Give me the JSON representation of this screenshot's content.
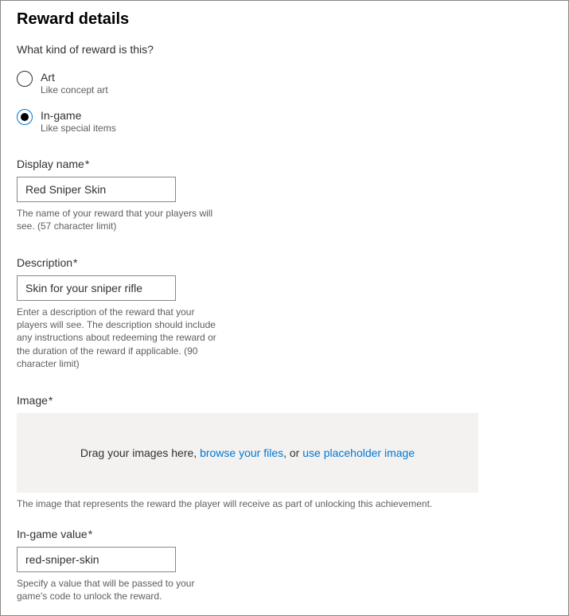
{
  "title": "Reward details",
  "question": "What kind of reward is this?",
  "radios": {
    "art": {
      "label": "Art",
      "sub": "Like concept art"
    },
    "ingame": {
      "label": "In-game",
      "sub": "Like special items"
    }
  },
  "display_name": {
    "label": "Display name",
    "value": "Red Sniper Skin",
    "help": "The name of your reward that your players will see. (57 character limit)"
  },
  "description": {
    "label": "Description",
    "value": "Skin for your sniper rifle",
    "help": "Enter a description of the reward that your players will see. The description should include any instructions about redeeming the reward or the duration of the reward if applicable. (90 character limit)"
  },
  "image": {
    "label": "Image",
    "drop_prefix": "Drag your images here, ",
    "browse": "browse your files",
    "mid": ", or ",
    "placeholder": "use placeholder image",
    "help": "The image that represents the reward the player will receive as part of unlocking this achievement."
  },
  "ingame_value": {
    "label": "In-game value",
    "value": "red-sniper-skin",
    "help": "Specify a value that will be passed to your game's code to unlock the reward."
  }
}
